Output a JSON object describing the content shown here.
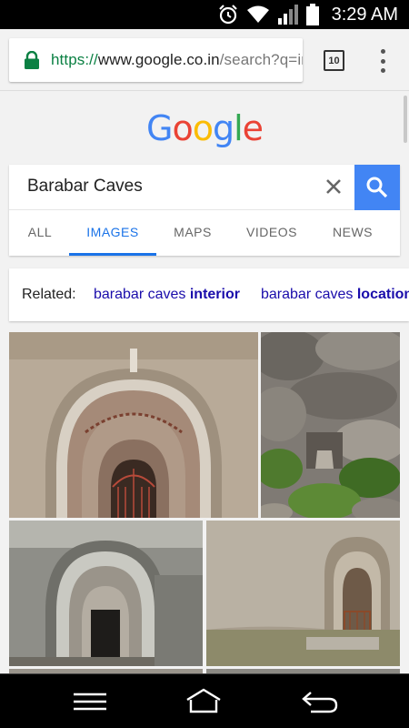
{
  "status_bar": {
    "time": "3:29 AM",
    "icons": [
      "alarm-icon",
      "wifi-icon",
      "signal-icon",
      "battery-icon"
    ]
  },
  "browser": {
    "url_scheme": "https://",
    "url_host": "www.google.co.in",
    "url_path": "/search?q=im",
    "tab_count": "10"
  },
  "google_logo": {
    "letters": [
      "G",
      "o",
      "o",
      "g",
      "l",
      "e"
    ],
    "colors": [
      "#4285f4",
      "#ea4335",
      "#fbbc05",
      "#4285f4",
      "#34a853",
      "#ea4335"
    ]
  },
  "search": {
    "query": "Barabar Caves",
    "tabs": [
      {
        "label": "ALL",
        "active": false
      },
      {
        "label": "IMAGES",
        "active": true
      },
      {
        "label": "MAPS",
        "active": false
      },
      {
        "label": "VIDEOS",
        "active": false
      },
      {
        "label": "NEWS",
        "active": false
      }
    ]
  },
  "related": {
    "label": "Related:",
    "items": [
      {
        "plain": "barabar caves",
        "bold": "interior"
      },
      {
        "plain": "barabar caves",
        "bold": "location"
      }
    ]
  },
  "results": [
    "cave-arch-entrance-image",
    "rocky-hillside-image",
    "cave-doorway-image",
    "cave-rock-wall-image"
  ],
  "accent_color": "#4285f4"
}
